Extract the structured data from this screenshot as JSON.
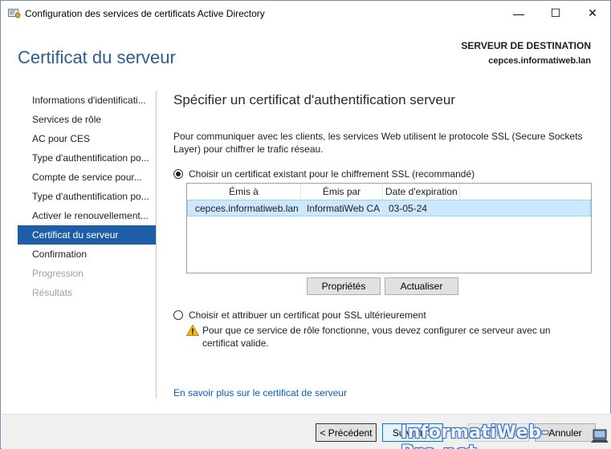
{
  "window": {
    "title": "Configuration des services de certificats Active Directory",
    "minimize_glyph": "—",
    "maximize_glyph": "☐",
    "close_glyph": "✕"
  },
  "header": {
    "title": "Certificat du serveur",
    "destination_label": "SERVEUR DE DESTINATION",
    "destination_server": "cepces.informatiweb.lan"
  },
  "sidebar": {
    "items": [
      {
        "label": "Informations d'identificati...",
        "state": "normal"
      },
      {
        "label": "Services de rôle",
        "state": "normal"
      },
      {
        "label": "AC pour CES",
        "state": "normal"
      },
      {
        "label": "Type d'authentification po...",
        "state": "normal"
      },
      {
        "label": "Compte de service pour...",
        "state": "normal"
      },
      {
        "label": "Type d'authentification po...",
        "state": "normal"
      },
      {
        "label": "Activer le renouvellement...",
        "state": "normal"
      },
      {
        "label": "Certificat du serveur",
        "state": "active"
      },
      {
        "label": "Confirmation",
        "state": "normal"
      },
      {
        "label": "Progression",
        "state": "disabled"
      },
      {
        "label": "Résultats",
        "state": "disabled"
      }
    ]
  },
  "main": {
    "title": "Spécifier un certificat d'authentification serveur",
    "description": "Pour communiquer avec les clients, les services Web utilisent le protocole SSL (Secure Sockets Layer) pour chiffrer le trafic réseau.",
    "option_existing": "Choisir un certificat existant pour le chiffrement SSL (recommandé)",
    "option_existing_checked": true,
    "certificates": {
      "columns": [
        "Émis à",
        "Émis par",
        "Date d'expiration"
      ],
      "rows": [
        [
          "cepces.informatiweb.lan",
          "InformatiWeb CA",
          "03-05-24"
        ]
      ]
    },
    "properties_button": "Propriétés",
    "refresh_button": "Actualiser",
    "option_later": "Choisir et attribuer un certificat pour SSL ultérieurement",
    "option_later_checked": false,
    "warning_text": "Pour que ce service de rôle fonctionne, vous devez configurer ce serveur avec un certificat valide.",
    "learn_more_link": "En savoir plus sur le certificat de serveur"
  },
  "footer": {
    "previous": "< Précédent",
    "next": "Suivant >",
    "configure": "Configurer",
    "cancel": "Annuler"
  },
  "watermark": "InformatiWeb-Pro.net",
  "colors": {
    "accent": "#1e5ea8",
    "header_title": "#2d5d8f",
    "selected_row": "#cce8ff",
    "link": "#0a5cb8"
  }
}
